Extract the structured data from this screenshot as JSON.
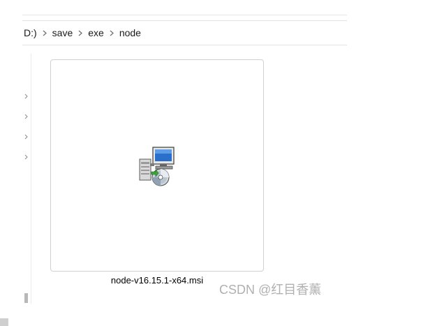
{
  "breadcrumb": {
    "drive_fragment": "D:)",
    "segments": [
      "save",
      "exe",
      "node"
    ]
  },
  "file": {
    "name": "node-v16.15.1-x64.msi",
    "icon": "msi-installer-icon"
  },
  "watermark": {
    "text": "CSDN @红目香薰"
  },
  "colors": {
    "tile_border": "#d0d0d0",
    "watermark": "#b0b0b0",
    "separator": "#6b6b6b"
  }
}
